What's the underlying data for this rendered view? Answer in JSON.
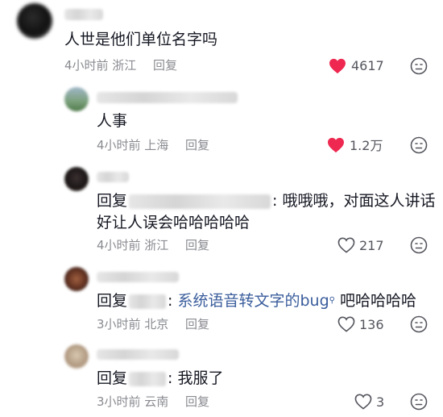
{
  "comments": [
    {
      "text": "人世是他们单位名字吗",
      "meta": "4小时前 浙江",
      "reply_label": "回复",
      "likes": "4617",
      "liked": true
    },
    {
      "text": "人事",
      "meta": "4小时前 上海",
      "reply_label": "回复",
      "likes": "1.2万",
      "liked": true
    },
    {
      "reply_prefix": "回复",
      "text_after": ": 哦哦哦，对面这人讲话",
      "text_line2": "好让人误会哈哈哈哈哈",
      "meta": "4小时前 浙江",
      "reply_label": "回复",
      "likes": "217",
      "liked": false
    },
    {
      "reply_prefix": "回复",
      "colon": ": ",
      "link_text": "系统语音转文字的bug",
      "text_after": " 吧哈哈哈哈",
      "meta": "3小时前 北京",
      "reply_label": "回复",
      "likes": "136",
      "liked": false
    },
    {
      "reply_prefix": "回复",
      "text_after": ": 我服了",
      "meta": "3小时前 云南",
      "reply_label": "回复",
      "likes": "3",
      "liked": false
    }
  ],
  "colors": {
    "liked_heart": "#ee2850",
    "link": "#3a5d9c",
    "meta_gray": "#8a8b91"
  }
}
